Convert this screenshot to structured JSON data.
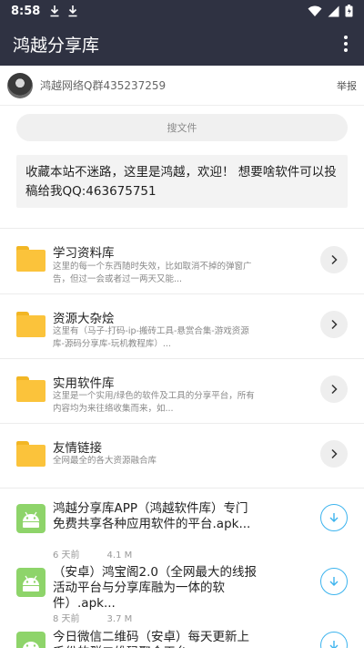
{
  "status_bar": {
    "time": "8:58"
  },
  "app_bar": {
    "title": "鸿越分享库"
  },
  "group": {
    "text": "鸿越网络Q群435237259",
    "report_label": "举报"
  },
  "search": {
    "placeholder": "搜文件"
  },
  "notice": {
    "text": "收藏本站不迷路，这里是鸿越，欢迎！ 想要啥软件可以投稿给我QQ:463675751"
  },
  "categories": [
    {
      "title": "学习资料库",
      "desc": "这里的每一个东西随时失效，比如取消不掉的弹窗广告，但过一会或者过一两天又能..."
    },
    {
      "title": "资源大杂烩",
      "desc": "这里有（马子-打码-ip-搬砖工具-悬赏合集-游戏资源库-源码分享库-玩机教程库）..."
    },
    {
      "title": "实用软件库",
      "desc": "这里是一个实用/绿色的软件及工具的分享平台，所有内容均为来往络收集而来，如..."
    },
    {
      "title": "友情链接",
      "desc": "全网最全的各大资源融合库"
    }
  ],
  "files": [
    {
      "title": "鸿越分享库APP（鸿越软件库）专门免费共享各种应用软件的平台.apk...",
      "age": "6 天前",
      "size": "4.1 M"
    },
    {
      "title": "（安卓）鸿宝阁2.0（全网最大的线报活动平台与分享库融为一体的软件）.apk...",
      "age": "8 天前",
      "size": "3.7 M"
    },
    {
      "title": "今日微信二维码（安卓）每天更新上千份的群二维码聚合平台",
      "age": "",
      "size": ""
    }
  ],
  "colors": {
    "bar": "#2f3242",
    "folder": "#fbc33b",
    "android": "#8ed46a",
    "download_accent": "#3db4ee"
  }
}
